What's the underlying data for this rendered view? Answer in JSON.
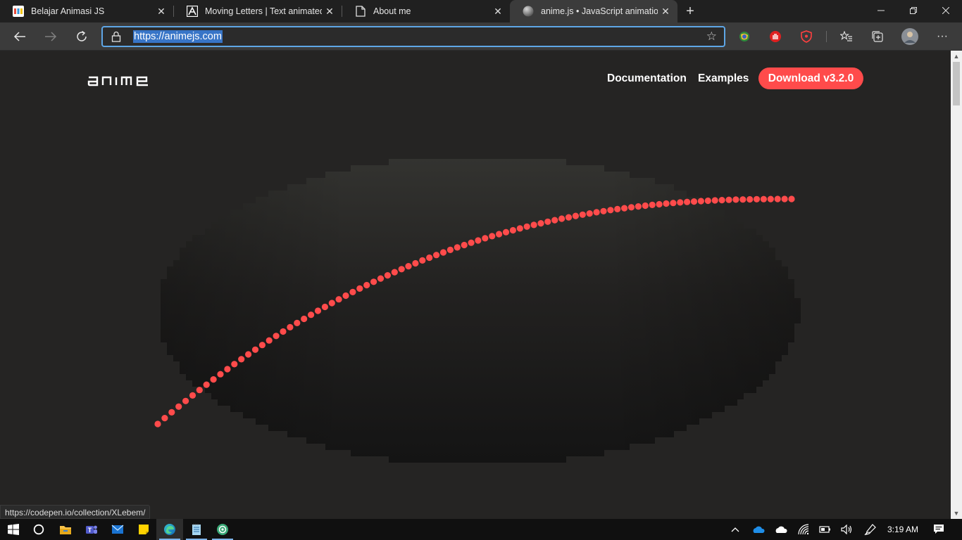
{
  "browser": {
    "tabs": [
      {
        "title": "Belajar Animasi JS",
        "icon": "colorful-grid-favicon",
        "active": false
      },
      {
        "title": "Moving Letters | Text animated w",
        "icon": "moving-letters-favicon",
        "active": false
      },
      {
        "title": "About me",
        "icon": "page-icon",
        "active": false
      },
      {
        "title": "anime.js • JavaScript animation e",
        "icon": "sphere-favicon",
        "active": true
      }
    ],
    "address_bar": {
      "url": "https://animejs.com"
    },
    "status_url": "https://codepen.io/collection/XLebem/"
  },
  "site": {
    "logo_text": "anime",
    "nav": {
      "documentation": "Documentation",
      "examples": "Examples",
      "download": "Download v3.2.0"
    },
    "colors": {
      "accent": "#ff4b4b",
      "background": "#252423"
    }
  },
  "taskbar": {
    "apps": [
      "start-icon",
      "cortana-icon",
      "file-explorer-icon",
      "teams-icon",
      "mail-icon",
      "sticky-notes-icon",
      "edge-icon",
      "notepad-icon",
      "app-icon"
    ],
    "clock": "3:19 AM"
  }
}
